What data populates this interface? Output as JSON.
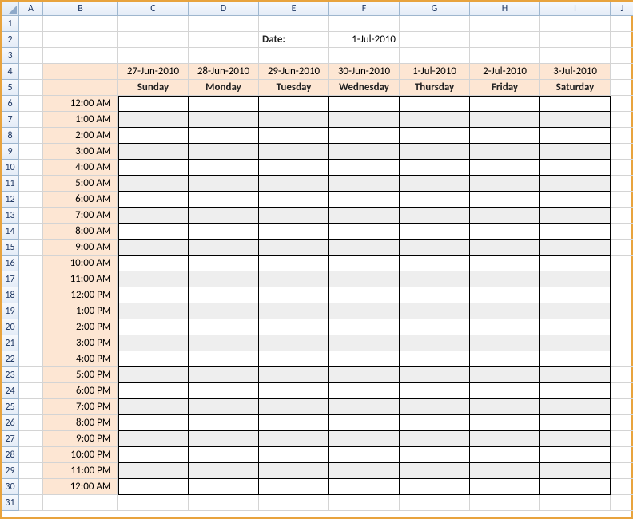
{
  "columns": [
    "A",
    "B",
    "C",
    "D",
    "E",
    "F",
    "G",
    "H",
    "I",
    "J"
  ],
  "rowCount": 31,
  "dateLabel": "Date:",
  "dateValue": "1-Jul-2010",
  "headerDates": [
    "27-Jun-2010",
    "28-Jun-2010",
    "29-Jun-2010",
    "30-Jun-2010",
    "1-Jul-2010",
    "2-Jul-2010",
    "3-Jul-2010"
  ],
  "headerDays": [
    "Sunday",
    "Monday",
    "Tuesday",
    "Wednesday",
    "Thursday",
    "Friday",
    "Saturday"
  ],
  "times": [
    "12:00 AM",
    "1:00 AM",
    "2:00 AM",
    "3:00 AM",
    "4:00 AM",
    "5:00 AM",
    "6:00 AM",
    "7:00 AM",
    "8:00 AM",
    "9:00 AM",
    "10:00 AM",
    "11:00 AM",
    "12:00 PM",
    "1:00 PM",
    "2:00 PM",
    "3:00 PM",
    "4:00 PM",
    "5:00 PM",
    "6:00 PM",
    "7:00 PM",
    "8:00 PM",
    "9:00 PM",
    "10:00 PM",
    "11:00 PM",
    "12:00 AM"
  ],
  "chart_data": {
    "type": "table",
    "title": "Weekly hourly schedule",
    "columns": [
      "Sunday",
      "Monday",
      "Tuesday",
      "Wednesday",
      "Thursday",
      "Friday",
      "Saturday"
    ],
    "column_dates": [
      "27-Jun-2010",
      "28-Jun-2010",
      "29-Jun-2010",
      "30-Jun-2010",
      "1-Jul-2010",
      "2-Jul-2010",
      "3-Jul-2010"
    ],
    "rows": [
      "12:00 AM",
      "1:00 AM",
      "2:00 AM",
      "3:00 AM",
      "4:00 AM",
      "5:00 AM",
      "6:00 AM",
      "7:00 AM",
      "8:00 AM",
      "9:00 AM",
      "10:00 AM",
      "11:00 AM",
      "12:00 PM",
      "1:00 PM",
      "2:00 PM",
      "3:00 PM",
      "4:00 PM",
      "5:00 PM",
      "6:00 PM",
      "7:00 PM",
      "8:00 PM",
      "9:00 PM",
      "10:00 PM",
      "11:00 PM",
      "12:00 AM"
    ],
    "values": []
  }
}
